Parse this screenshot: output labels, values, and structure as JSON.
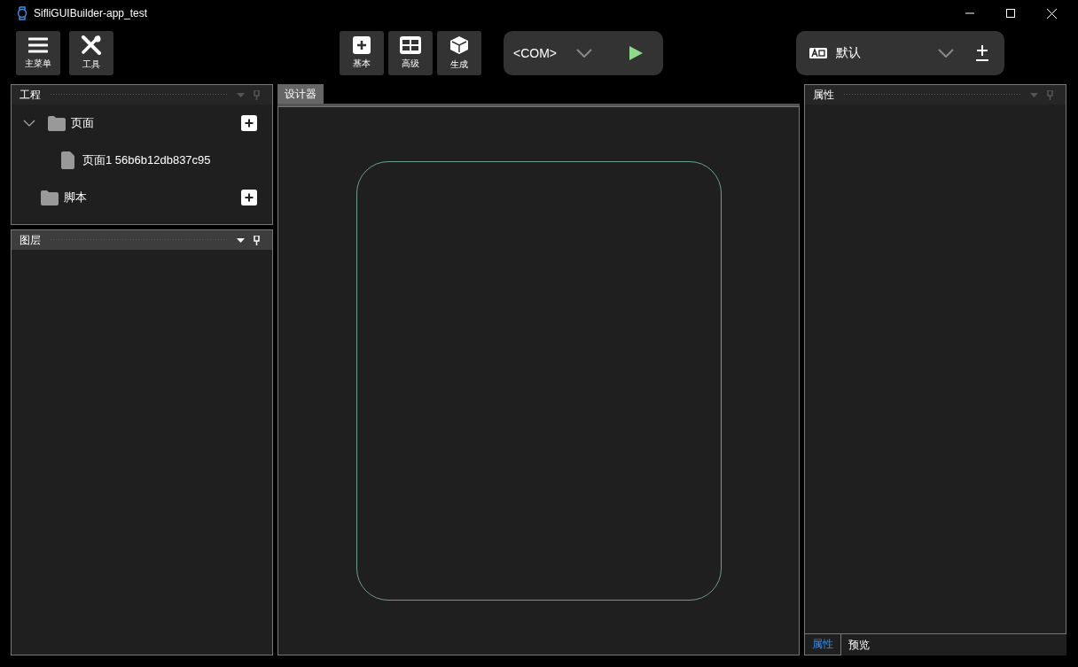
{
  "window": {
    "title": "SifliGUIBuilder-app_test"
  },
  "toolbar": {
    "left_buttons": [
      {
        "label": "主菜单",
        "kind": "menu"
      },
      {
        "label": "工具",
        "kind": "tools"
      }
    ],
    "center_buttons": [
      {
        "label": "基本",
        "kind": "plus"
      },
      {
        "label": "高级",
        "kind": "grid"
      },
      {
        "label": "生成",
        "kind": "cube"
      }
    ],
    "port_selector": {
      "value": "<COM>"
    },
    "theme_selector": {
      "value": "默认"
    }
  },
  "project_panel": {
    "title": "工程",
    "focused": false,
    "tree": [
      {
        "label": "页面",
        "kind": "folder",
        "expanded": true,
        "children": [
          {
            "label": "页面1 56b6b12db837c95",
            "kind": "file"
          }
        ]
      },
      {
        "label": "脚本",
        "kind": "folder",
        "expanded": false
      }
    ]
  },
  "layers_panel": {
    "title": "图层",
    "focused": true
  },
  "designer": {
    "tabs": [
      {
        "label": "设计器",
        "selected": true
      }
    ]
  },
  "properties_panel": {
    "title": "属性",
    "focused": false,
    "tabs": [
      {
        "label": "属性",
        "selected": true
      },
      {
        "label": "预览",
        "selected": false
      }
    ]
  }
}
